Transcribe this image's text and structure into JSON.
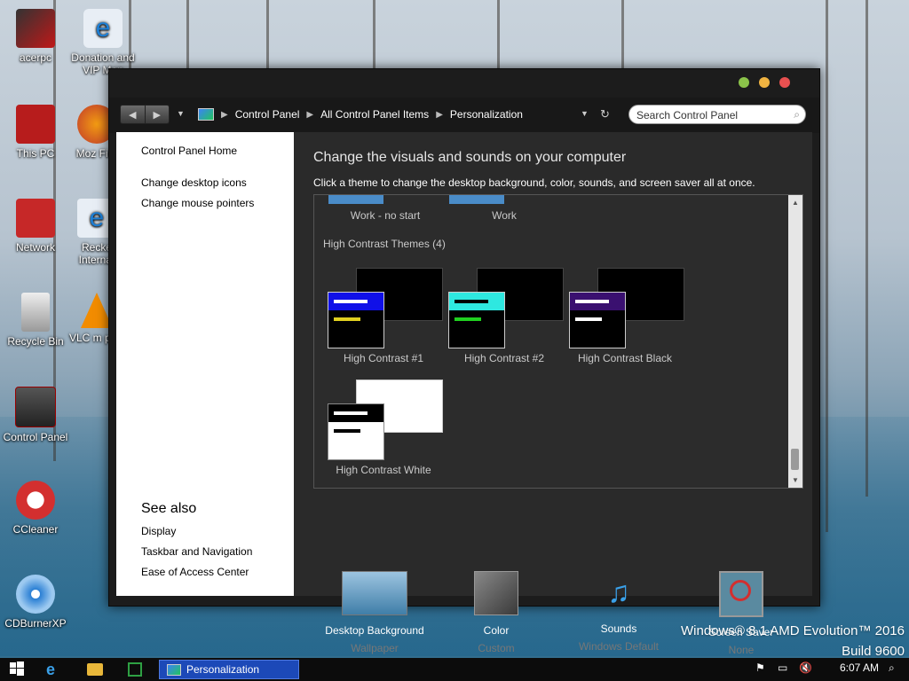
{
  "desktop": {
    "icons": [
      {
        "label": "acerpc"
      },
      {
        "label": "Donation and VIP Men"
      },
      {
        "label": "This PC"
      },
      {
        "label": "Moz Fire"
      },
      {
        "label": "Network"
      },
      {
        "label": "Recke Internat"
      },
      {
        "label": "Recycle Bin"
      },
      {
        "label": "VLC m play"
      },
      {
        "label": "Control Panel"
      },
      {
        "label": "CCleaner"
      },
      {
        "label": "CDBurnerXP"
      }
    ],
    "watermark_line1": "Windows® 8.1 AMD Evolution™ 2016",
    "watermark_line2": "Build 9600"
  },
  "window": {
    "breadcrumb": [
      "Control Panel",
      "All Control Panel Items",
      "Personalization"
    ],
    "search_placeholder": "Search Control Panel",
    "left_pane": {
      "home": "Control Panel Home",
      "links": [
        "Change desktop icons",
        "Change mouse pointers"
      ],
      "see_also_heading": "See also",
      "see_also": [
        "Display",
        "Taskbar and Navigation",
        "Ease of Access Center"
      ]
    },
    "main": {
      "heading": "Change the visuals and sounds on your computer",
      "subheading": "Click a theme to change the desktop background, color, sounds, and screen saver all at once.",
      "partial_themes": [
        "Work - no start",
        "Work"
      ],
      "section_title": "High Contrast Themes (4)",
      "themes": [
        {
          "label": "High Contrast #1",
          "accent": "#1010e8",
          "line2": "#e0d020"
        },
        {
          "label": "High Contrast #2",
          "accent": "#2ee8e0",
          "line2": "#20d020"
        },
        {
          "label": "High Contrast Black",
          "accent": "#3a1070",
          "line2": "#ffffff"
        },
        {
          "label": "High Contrast White",
          "accent": "#000000",
          "line2": "#000000"
        }
      ],
      "bottom": [
        {
          "title": "Desktop Background",
          "sub": "Wallpaper",
          "icon": "wallpaper-icon"
        },
        {
          "title": "Color",
          "sub": "Custom",
          "icon": "color-icon"
        },
        {
          "title": "Sounds",
          "sub": "Windows Default",
          "icon": "sounds-icon"
        },
        {
          "title": "Screen Saver",
          "sub": "None",
          "icon": "screensaver-icon"
        }
      ]
    }
  },
  "taskbar": {
    "task_label": "Personalization",
    "clock": "6:07 AM"
  }
}
